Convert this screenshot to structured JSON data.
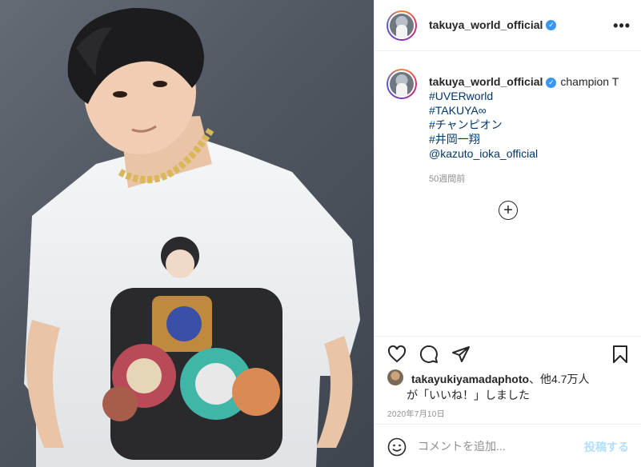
{
  "post": {
    "username": "takuya_world_official",
    "caption": "champion T",
    "hashtags": [
      "#UVERworld",
      "#TAKUYA∞",
      "#チャンピオン",
      "#井岡一翔"
    ],
    "mention": "@kazuto_ioka_official",
    "time_ago": "50週間前",
    "more_icon": "•••"
  },
  "likes": {
    "first_liker": "takayukiyamadaphoto",
    "others": "、他4.7万人",
    "suffix": "が「いいね！」しました"
  },
  "date": "2020年7月10日",
  "comment": {
    "placeholder": "コメントを追加...",
    "post_label": "投稿する"
  },
  "colors": {
    "link": "#00376b",
    "verified": "#3897f0",
    "post_button_disabled": "#b2dffc",
    "muted": "#8e8e8e"
  }
}
